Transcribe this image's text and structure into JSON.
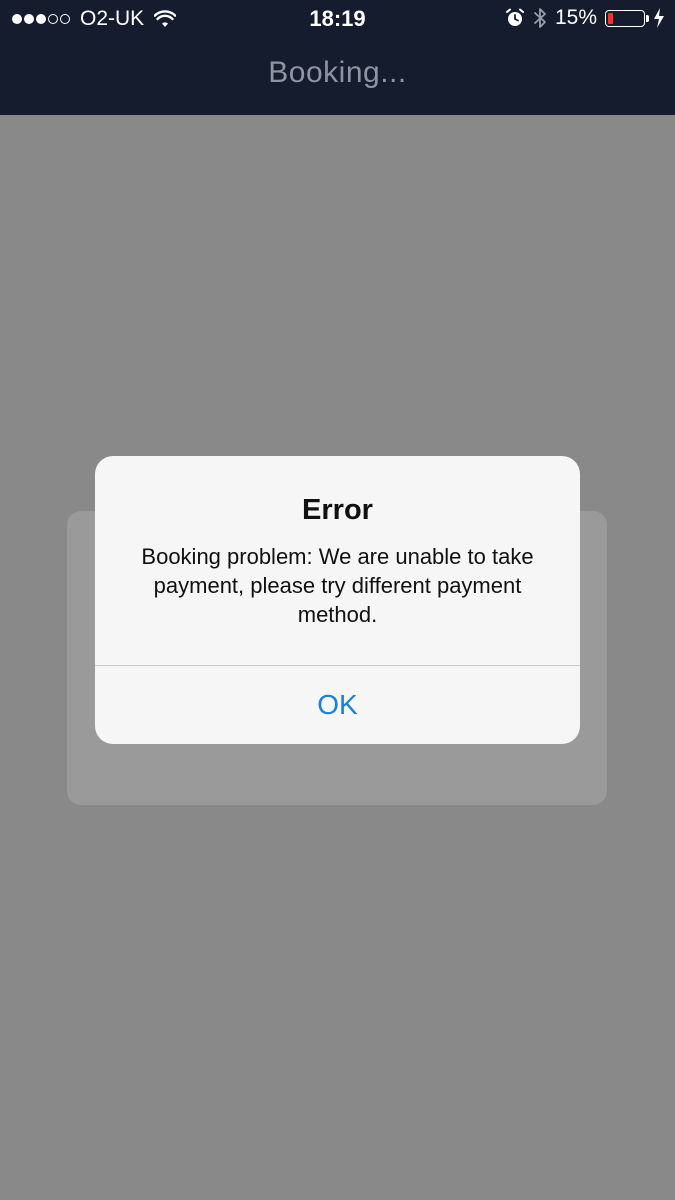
{
  "status_bar": {
    "signal_dots_filled": 3,
    "signal_dots_total": 5,
    "carrier": "O2-UK",
    "time": "18:19",
    "battery_percent_text": "15%",
    "battery_level": 0.15,
    "icons": [
      "wifi-icon",
      "alarm-icon",
      "bluetooth-icon",
      "battery-icon",
      "charging-bolt-icon"
    ]
  },
  "nav": {
    "title": "Booking..."
  },
  "alert": {
    "title": "Error",
    "message": "Booking problem: We are unable to take payment, please try different payment method.",
    "ok_label": "OK"
  },
  "colors": {
    "nav_background": "#141c2e",
    "overlay": "#898989",
    "alert_background": "#f6f6f6",
    "ok_text": "#1a7fe0",
    "battery_low": "#ff2d2d"
  }
}
